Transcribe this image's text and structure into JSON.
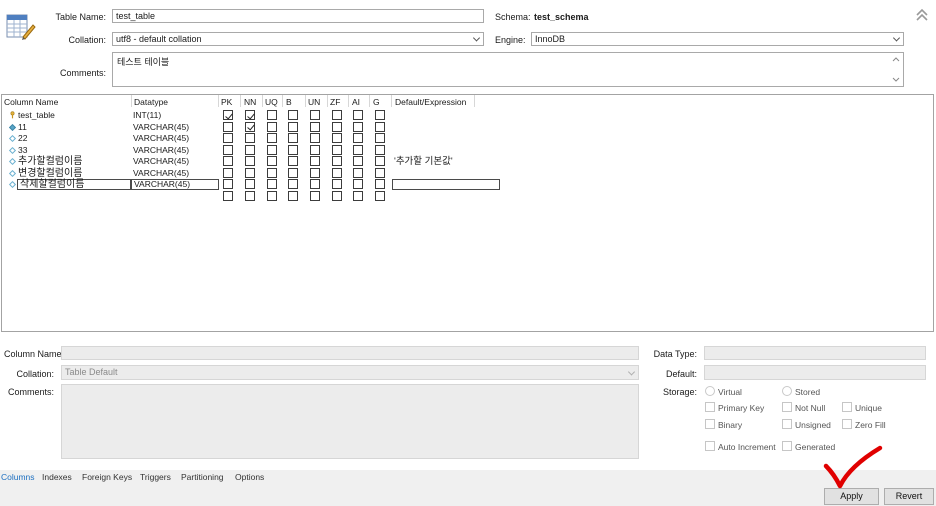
{
  "table_editor": {
    "table_name_label": "Table Name:",
    "table_name_value": "test_table",
    "schema_label": "Schema:",
    "schema_value": "test_schema",
    "collation_label": "Collation:",
    "collation_value": "utf8 - default collation",
    "engine_label": "Engine:",
    "engine_value": "InnoDB",
    "comments_label": "Comments:",
    "comments_value": "테스트 테이블"
  },
  "grid": {
    "headers": [
      "Column Name",
      "Datatype",
      "PK",
      "NN",
      "UQ",
      "B",
      "UN",
      "ZF",
      "AI",
      "G",
      "Default/Expression"
    ],
    "rows": [
      {
        "name": "test_table",
        "datatype": "INT(11)",
        "icon": "key",
        "flags": [
          true,
          true,
          false,
          false,
          false,
          false,
          false,
          false
        ],
        "default": ""
      },
      {
        "name": "11",
        "datatype": "VARCHAR(45)",
        "icon": "filled",
        "flags": [
          false,
          true,
          false,
          false,
          false,
          false,
          false,
          false
        ],
        "default": ""
      },
      {
        "name": "22",
        "datatype": "VARCHAR(45)",
        "icon": "hollow",
        "flags": [
          false,
          false,
          false,
          false,
          false,
          false,
          false,
          false
        ],
        "default": ""
      },
      {
        "name": "33",
        "datatype": "VARCHAR(45)",
        "icon": "hollow",
        "flags": [
          false,
          false,
          false,
          false,
          false,
          false,
          false,
          false
        ],
        "default": ""
      },
      {
        "name": "추가할컬럼이름",
        "datatype": "VARCHAR(45)",
        "icon": "hollow",
        "flags": [
          false,
          false,
          false,
          false,
          false,
          false,
          false,
          false
        ],
        "default": "'추가할 기본값'"
      },
      {
        "name": "변경할컬럼이름",
        "datatype": "VARCHAR(45)",
        "icon": "hollow",
        "flags": [
          false,
          false,
          false,
          false,
          false,
          false,
          false,
          false
        ],
        "default": ""
      },
      {
        "name": "삭제할컬럼이름",
        "datatype": "VARCHAR(45)",
        "icon": "hollow",
        "flags": [
          false,
          false,
          false,
          false,
          false,
          false,
          false,
          false
        ],
        "default": "",
        "editing": true
      }
    ]
  },
  "details": {
    "column_name_label": "Column Name:",
    "collation_label": "Collation:",
    "collation_value": "Table Default",
    "comments_label": "Comments:",
    "data_type_label": "Data Type:",
    "default_label": "Default:",
    "storage_label": "Storage:",
    "virtual_label": "Virtual",
    "stored_label": "Stored",
    "primary_key_label": "Primary Key",
    "not_null_label": "Not Null",
    "unique_label": "Unique",
    "binary_label": "Binary",
    "unsigned_label": "Unsigned",
    "zero_fill_label": "Zero Fill",
    "auto_increment_label": "Auto Increment",
    "generated_label": "Generated"
  },
  "tabs": [
    "Columns",
    "Indexes",
    "Foreign Keys",
    "Triggers",
    "Partitioning",
    "Options"
  ],
  "buttons": {
    "apply": "Apply",
    "revert": "Revert"
  },
  "colors": {
    "accent_tab": "#1e70c1",
    "annotation_check": "#e00000"
  }
}
